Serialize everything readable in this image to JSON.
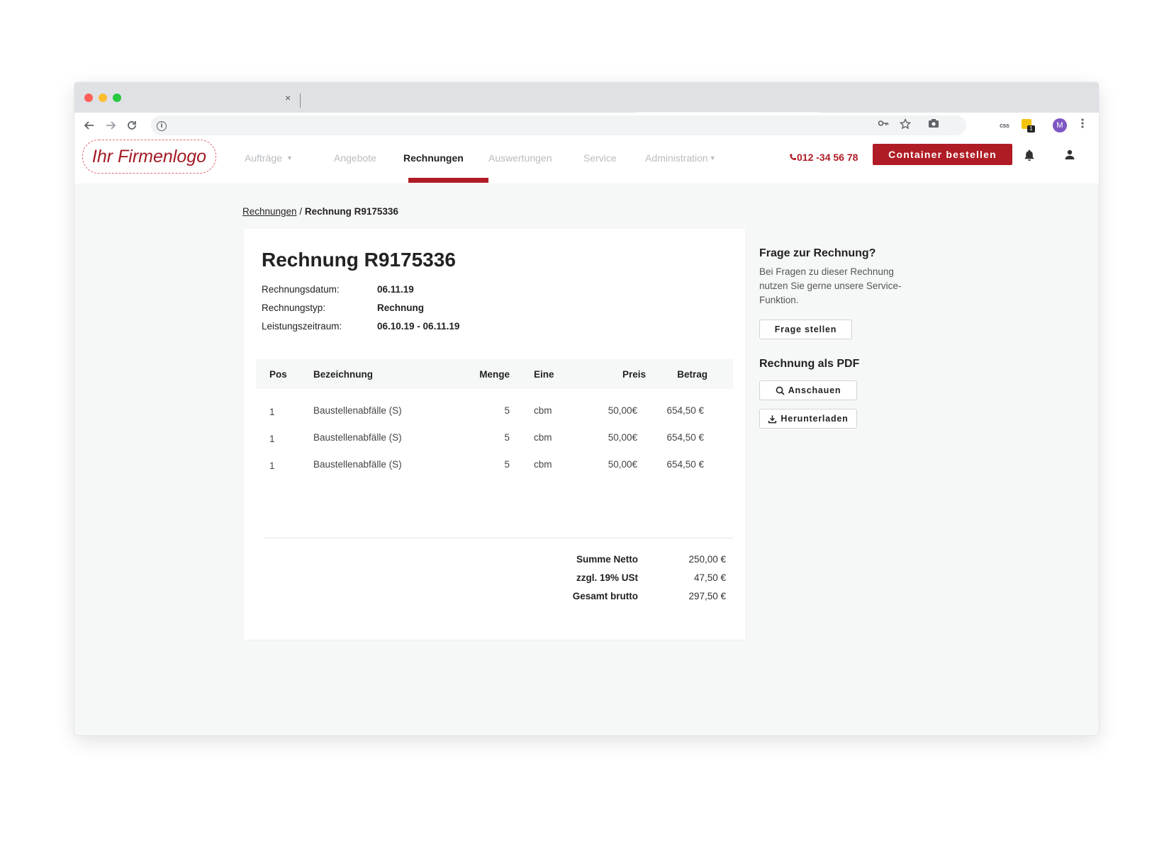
{
  "browser": {
    "tab_close_glyph": "×",
    "extension_badge": "1",
    "css_ext_label": "css",
    "profile_initial": "M"
  },
  "nav": {
    "logo": "Ihr Firmenlogo",
    "items": [
      {
        "label": "Aufträge",
        "has_dropdown": true
      },
      {
        "label": "Angebote"
      },
      {
        "label": "Rechnungen",
        "active": true
      },
      {
        "label": "Auswertungen"
      },
      {
        "label": "Service"
      },
      {
        "label": "Administration",
        "has_dropdown": true
      }
    ],
    "phone": "012 -34 56 78",
    "order_button": "Container bestellen",
    "accent_color": "#b01c25"
  },
  "breadcrumb": {
    "parent": "Rechnungen",
    "separator": "/",
    "current": "Rechnung R9175336"
  },
  "invoice": {
    "title": "Rechnung R9175336",
    "meta": [
      {
        "label": "Rechnungsdatum:",
        "value": "06.11.19"
      },
      {
        "label": "Rechnungstyp:",
        "value": "Rechnung"
      },
      {
        "label": "Leistungszeitraum:",
        "value": "06.10.19 - 06.11.19"
      }
    ],
    "table": {
      "headers": {
        "pos": "Pos",
        "bezeichnung": "Bezeichnung",
        "menge": "Menge",
        "eine": "Eine",
        "preis": "Preis",
        "betrag": "Betrag"
      },
      "rows": [
        {
          "pos": "1",
          "bezeichnung": "Baustellenabfälle (S)",
          "menge": "5",
          "eine": "cbm",
          "preis": "50,00€",
          "betrag": "654,50 €"
        },
        {
          "pos": "1",
          "bezeichnung": "Baustellenabfälle (S)",
          "menge": "5",
          "eine": "cbm",
          "preis": "50,00€",
          "betrag": "654,50 €"
        },
        {
          "pos": "1",
          "bezeichnung": "Baustellenabfälle (S)",
          "menge": "5",
          "eine": "cbm",
          "preis": "50,00€",
          "betrag": "654,50 €"
        }
      ]
    },
    "totals": [
      {
        "label": "Summe Netto",
        "value": "250,00 €"
      },
      {
        "label": "zzgl. 19% USt",
        "value": "47,50 €"
      },
      {
        "label": "Gesamt brutto",
        "value": "297,50 €"
      }
    ]
  },
  "sidebar": {
    "question_heading": "Frage zur Rechnung?",
    "question_text": "Bei Fragen zu dieser Rechnung nutzen Sie gerne unsere Service-Funktion.",
    "question_button": "Frage stellen",
    "pdf_heading": "Rechnung als PDF",
    "view_button": "Anschauen",
    "download_button": "Herunterladen"
  }
}
